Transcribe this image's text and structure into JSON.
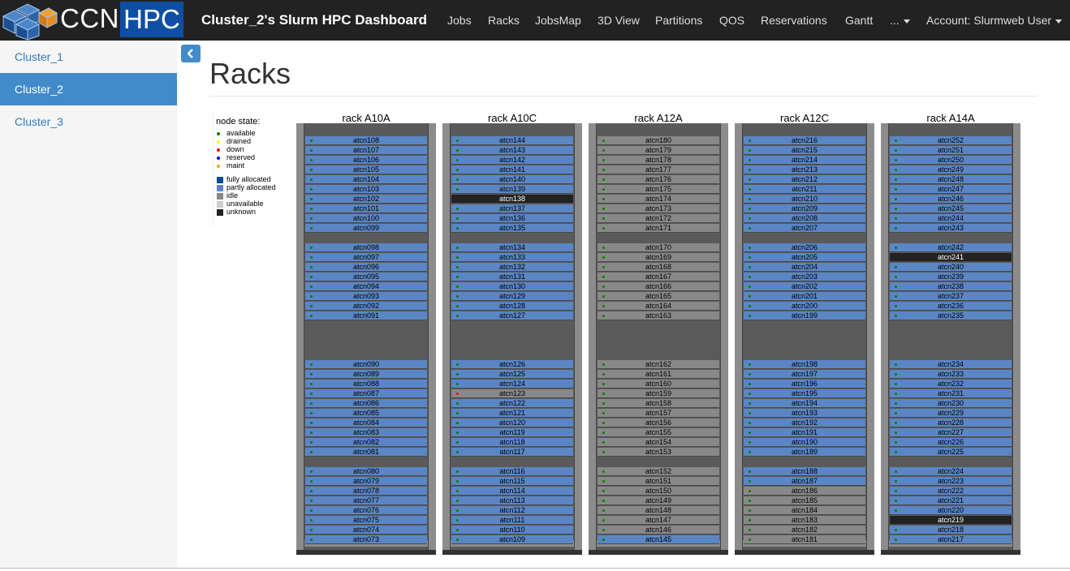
{
  "navbar": {
    "brand_left": "CCN",
    "brand_right": "HPC",
    "title": "Cluster_2's Slurm HPC Dashboard",
    "items": [
      "Jobs",
      "Racks",
      "JobsMap",
      "3D View",
      "Partitions",
      "QOS",
      "Reservations",
      "Gantt"
    ],
    "more_label": "...",
    "account_label": "Account: Slurmweb User"
  },
  "sidebar": {
    "items": [
      {
        "label": "Cluster_1",
        "active": false
      },
      {
        "label": "Cluster_2",
        "active": true
      },
      {
        "label": "Cluster_3",
        "active": false
      }
    ]
  },
  "page": {
    "title": "Racks"
  },
  "legend": {
    "heading": "node state:",
    "states": [
      {
        "label": "available",
        "color": "#008000"
      },
      {
        "label": "drained",
        "color": "#ffff00"
      },
      {
        "label": "down",
        "color": "#ff0000"
      },
      {
        "label": "reserved",
        "color": "#0000ff"
      },
      {
        "label": "maint",
        "color": "#ffa500"
      }
    ],
    "allocations": [
      {
        "label": "fully allocated",
        "color": "#0e4d8c"
      },
      {
        "label": "partly allocated",
        "color": "#5a86c5"
      },
      {
        "label": "idle",
        "color": "#888888"
      },
      {
        "label": "unavailable",
        "color": "#cccccc"
      },
      {
        "label": "unknown",
        "color": "#222222"
      }
    ]
  },
  "colors": {
    "available": "#008000",
    "down": "#ff0000"
  },
  "racks": [
    {
      "name": "rack A10A",
      "groups": [
        [
          [
            "atcn108",
            "alloc",
            "available"
          ],
          [
            "atcn107",
            "alloc",
            "available"
          ],
          [
            "atcn106",
            "alloc",
            "available"
          ],
          [
            "atcn105",
            "alloc",
            "available"
          ],
          [
            "atcn104",
            "alloc",
            "available"
          ],
          [
            "atcn103",
            "alloc",
            "available"
          ],
          [
            "atcn102",
            "alloc",
            "available"
          ],
          [
            "atcn101",
            "alloc",
            "available"
          ],
          [
            "atcn100",
            "alloc",
            "available"
          ],
          [
            "atcn099",
            "alloc",
            "available"
          ]
        ],
        [
          [
            "atcn098",
            "alloc",
            "available"
          ],
          [
            "atcn097",
            "alloc",
            "available"
          ],
          [
            "atcn096",
            "alloc",
            "available"
          ],
          [
            "atcn095",
            "alloc",
            "available"
          ],
          [
            "atcn094",
            "alloc",
            "available"
          ],
          [
            "atcn093",
            "alloc",
            "available"
          ],
          [
            "atcn092",
            "alloc",
            "available"
          ],
          [
            "atcn091",
            "alloc",
            "available"
          ]
        ],
        [
          [
            "atcn090",
            "alloc",
            "available"
          ],
          [
            "atcn089",
            "alloc",
            "available"
          ],
          [
            "atcn088",
            "alloc",
            "available"
          ],
          [
            "atcn087",
            "alloc",
            "available"
          ],
          [
            "atcn086",
            "alloc",
            "available"
          ],
          [
            "atcn085",
            "alloc",
            "available"
          ],
          [
            "atcn084",
            "alloc",
            "available"
          ],
          [
            "atcn083",
            "alloc",
            "available"
          ],
          [
            "atcn082",
            "alloc",
            "available"
          ],
          [
            "atcn081",
            "alloc",
            "available"
          ]
        ],
        [
          [
            "atcn080",
            "alloc",
            "available"
          ],
          [
            "atcn079",
            "alloc",
            "available"
          ],
          [
            "atcn078",
            "alloc",
            "available"
          ],
          [
            "atcn077",
            "alloc",
            "available"
          ],
          [
            "atcn076",
            "alloc",
            "available"
          ],
          [
            "atcn075",
            "alloc",
            "available"
          ],
          [
            "atcn074",
            "alloc",
            "available"
          ],
          [
            "atcn073",
            "alloc",
            "available"
          ]
        ]
      ]
    },
    {
      "name": "rack A10C",
      "groups": [
        [
          [
            "atcn144",
            "alloc",
            "available"
          ],
          [
            "atcn143",
            "alloc",
            "available"
          ],
          [
            "atcn142",
            "alloc",
            "available"
          ],
          [
            "atcn141",
            "alloc",
            "available"
          ],
          [
            "atcn140",
            "alloc",
            "available"
          ],
          [
            "atcn139",
            "alloc",
            "available"
          ],
          [
            "atcn138",
            "unknown",
            ""
          ],
          [
            "atcn137",
            "alloc",
            "available"
          ],
          [
            "atcn136",
            "alloc",
            "available"
          ],
          [
            "atcn135",
            "alloc",
            "available"
          ]
        ],
        [
          [
            "atcn134",
            "alloc",
            "available"
          ],
          [
            "atcn133",
            "alloc",
            "available"
          ],
          [
            "atcn132",
            "alloc",
            "available"
          ],
          [
            "atcn131",
            "alloc",
            "available"
          ],
          [
            "atcn130",
            "alloc",
            "available"
          ],
          [
            "atcn129",
            "alloc",
            "available"
          ],
          [
            "atcn128",
            "alloc",
            "available"
          ],
          [
            "atcn127",
            "alloc",
            "available"
          ]
        ],
        [
          [
            "atcn126",
            "alloc",
            "available"
          ],
          [
            "atcn125",
            "alloc",
            "available"
          ],
          [
            "atcn124",
            "alloc",
            "available"
          ],
          [
            "atcn123",
            "idle",
            "down"
          ],
          [
            "atcn122",
            "alloc",
            "available"
          ],
          [
            "atcn121",
            "alloc",
            "available"
          ],
          [
            "atcn120",
            "alloc",
            "available"
          ],
          [
            "atcn119",
            "alloc",
            "available"
          ],
          [
            "atcn118",
            "alloc",
            "available"
          ],
          [
            "atcn117",
            "alloc",
            "available"
          ]
        ],
        [
          [
            "atcn116",
            "alloc",
            "available"
          ],
          [
            "atcn115",
            "alloc",
            "available"
          ],
          [
            "atcn114",
            "alloc",
            "available"
          ],
          [
            "atcn113",
            "alloc",
            "available"
          ],
          [
            "atcn112",
            "alloc",
            "available"
          ],
          [
            "atcn111",
            "alloc",
            "available"
          ],
          [
            "atcn110",
            "alloc",
            "available"
          ],
          [
            "atcn109",
            "alloc",
            "available"
          ]
        ]
      ]
    },
    {
      "name": "rack A12A",
      "groups": [
        [
          [
            "atcn180",
            "idle",
            "available"
          ],
          [
            "atcn179",
            "idle",
            "available"
          ],
          [
            "atcn178",
            "idle",
            "available"
          ],
          [
            "atcn177",
            "idle",
            "available"
          ],
          [
            "atcn176",
            "idle",
            "available"
          ],
          [
            "atcn175",
            "idle",
            "available"
          ],
          [
            "atcn174",
            "idle",
            "available"
          ],
          [
            "atcn173",
            "idle",
            "available"
          ],
          [
            "atcn172",
            "idle",
            "available"
          ],
          [
            "atcn171",
            "idle",
            "available"
          ]
        ],
        [
          [
            "atcn170",
            "idle",
            "available"
          ],
          [
            "atcn169",
            "idle",
            "available"
          ],
          [
            "atcn168",
            "idle",
            "available"
          ],
          [
            "atcn167",
            "idle",
            "available"
          ],
          [
            "atcn166",
            "idle",
            "available"
          ],
          [
            "atcn165",
            "idle",
            "available"
          ],
          [
            "atcn164",
            "idle",
            "available"
          ],
          [
            "atcn163",
            "idle",
            "available"
          ]
        ],
        [
          [
            "atcn162",
            "idle",
            "available"
          ],
          [
            "atcn161",
            "idle",
            "available"
          ],
          [
            "atcn160",
            "idle",
            "available"
          ],
          [
            "atcn159",
            "idle",
            "available"
          ],
          [
            "atcn158",
            "idle",
            "available"
          ],
          [
            "atcn157",
            "idle",
            "available"
          ],
          [
            "atcn156",
            "idle",
            "available"
          ],
          [
            "atcn155",
            "idle",
            "available"
          ],
          [
            "atcn154",
            "idle",
            "available"
          ],
          [
            "atcn153",
            "idle",
            "available"
          ]
        ],
        [
          [
            "atcn152",
            "idle",
            "available"
          ],
          [
            "atcn151",
            "idle",
            "available"
          ],
          [
            "atcn150",
            "idle",
            "available"
          ],
          [
            "atcn149",
            "idle",
            "available"
          ],
          [
            "atcn148",
            "idle",
            "available"
          ],
          [
            "atcn147",
            "idle",
            "available"
          ],
          [
            "atcn146",
            "idle",
            "available"
          ],
          [
            "atcn145",
            "alloc",
            "available"
          ]
        ]
      ]
    },
    {
      "name": "rack A12C",
      "groups": [
        [
          [
            "atcn216",
            "alloc",
            "available"
          ],
          [
            "atcn215",
            "alloc",
            "available"
          ],
          [
            "atcn214",
            "alloc",
            "available"
          ],
          [
            "atcn213",
            "alloc",
            "available"
          ],
          [
            "atcn212",
            "alloc",
            "available"
          ],
          [
            "atcn211",
            "alloc",
            "available"
          ],
          [
            "atcn210",
            "alloc",
            "available"
          ],
          [
            "atcn209",
            "alloc",
            "available"
          ],
          [
            "atcn208",
            "alloc",
            "available"
          ],
          [
            "atcn207",
            "alloc",
            "available"
          ]
        ],
        [
          [
            "atcn206",
            "alloc",
            "available"
          ],
          [
            "atcn205",
            "alloc",
            "available"
          ],
          [
            "atcn204",
            "alloc",
            "available"
          ],
          [
            "atcn203",
            "alloc",
            "available"
          ],
          [
            "atcn202",
            "alloc",
            "available"
          ],
          [
            "atcn201",
            "alloc",
            "available"
          ],
          [
            "atcn200",
            "alloc",
            "available"
          ],
          [
            "atcn199",
            "alloc",
            "available"
          ]
        ],
        [
          [
            "atcn198",
            "alloc",
            "available"
          ],
          [
            "atcn197",
            "alloc",
            "available"
          ],
          [
            "atcn196",
            "alloc",
            "available"
          ],
          [
            "atcn195",
            "alloc",
            "available"
          ],
          [
            "atcn194",
            "alloc",
            "available"
          ],
          [
            "atcn193",
            "alloc",
            "available"
          ],
          [
            "atcn192",
            "alloc",
            "available"
          ],
          [
            "atcn191",
            "alloc",
            "available"
          ],
          [
            "atcn190",
            "alloc",
            "available"
          ],
          [
            "atcn189",
            "alloc",
            "available"
          ]
        ],
        [
          [
            "atcn188",
            "alloc",
            "available"
          ],
          [
            "atcn187",
            "alloc",
            "available"
          ],
          [
            "atcn186",
            "idle",
            "available"
          ],
          [
            "atcn185",
            "idle",
            "available"
          ],
          [
            "atcn184",
            "idle",
            "available"
          ],
          [
            "atcn183",
            "idle",
            "available"
          ],
          [
            "atcn182",
            "idle",
            "available"
          ],
          [
            "atcn181",
            "idle",
            "available"
          ]
        ]
      ]
    },
    {
      "name": "rack A14A",
      "groups": [
        [
          [
            "atcn252",
            "alloc",
            "available"
          ],
          [
            "atcn251",
            "alloc",
            "available"
          ],
          [
            "atcn250",
            "alloc",
            "available"
          ],
          [
            "atcn249",
            "alloc",
            "available"
          ],
          [
            "atcn248",
            "alloc",
            "available"
          ],
          [
            "atcn247",
            "alloc",
            "available"
          ],
          [
            "atcn246",
            "alloc",
            "available"
          ],
          [
            "atcn245",
            "alloc",
            "available"
          ],
          [
            "atcn244",
            "alloc",
            "available"
          ],
          [
            "atcn243",
            "alloc",
            "available"
          ]
        ],
        [
          [
            "atcn242",
            "alloc",
            "available"
          ],
          [
            "atcn241",
            "unknown",
            ""
          ],
          [
            "atcn240",
            "alloc",
            "available"
          ],
          [
            "atcn239",
            "alloc",
            "available"
          ],
          [
            "atcn238",
            "alloc",
            "available"
          ],
          [
            "atcn237",
            "alloc",
            "available"
          ],
          [
            "atcn236",
            "alloc",
            "available"
          ],
          [
            "atcn235",
            "alloc",
            "available"
          ]
        ],
        [
          [
            "atcn234",
            "alloc",
            "available"
          ],
          [
            "atcn233",
            "alloc",
            "available"
          ],
          [
            "atcn232",
            "alloc",
            "available"
          ],
          [
            "atcn231",
            "alloc",
            "available"
          ],
          [
            "atcn230",
            "alloc",
            "available"
          ],
          [
            "atcn229",
            "alloc",
            "available"
          ],
          [
            "atcn228",
            "alloc",
            "available"
          ],
          [
            "atcn227",
            "alloc",
            "available"
          ],
          [
            "atcn226",
            "alloc",
            "available"
          ],
          [
            "atcn225",
            "alloc",
            "available"
          ]
        ],
        [
          [
            "atcn224",
            "alloc",
            "available"
          ],
          [
            "atcn223",
            "alloc",
            "available"
          ],
          [
            "atcn222",
            "alloc",
            "available"
          ],
          [
            "atcn221",
            "alloc",
            "available"
          ],
          [
            "atcn220",
            "alloc",
            "available"
          ],
          [
            "atcn219",
            "unknown",
            ""
          ],
          [
            "atcn218",
            "alloc",
            "available"
          ],
          [
            "atcn217",
            "alloc",
            "available"
          ]
        ]
      ]
    }
  ]
}
